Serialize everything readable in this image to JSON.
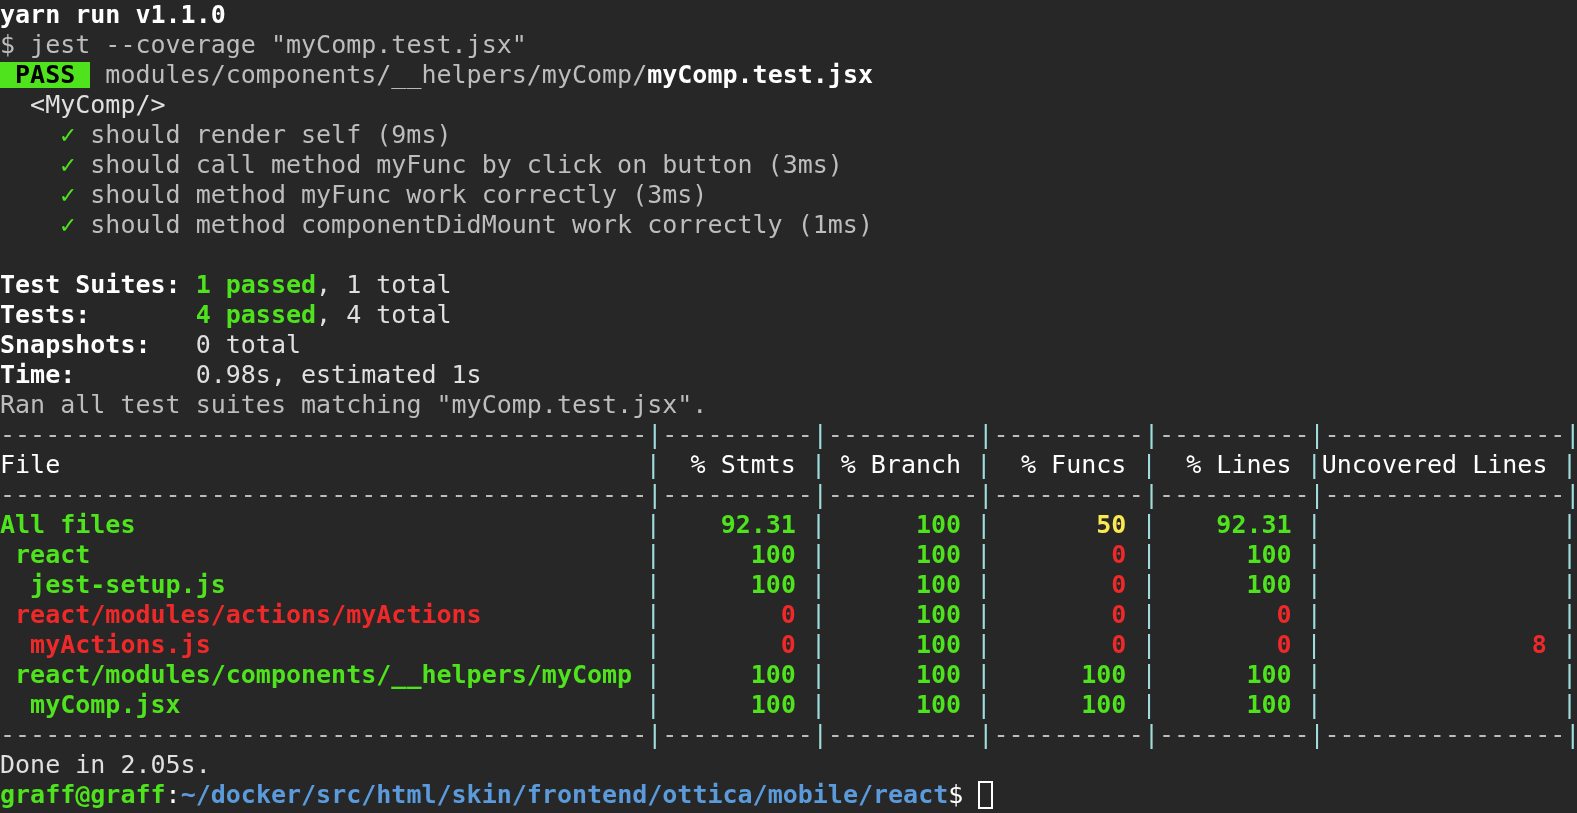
{
  "command": {
    "title": "yarn run v1.1.0",
    "prompt_line": "$ jest --coverage \"myComp.test.jsx\""
  },
  "result": {
    "badge": "PASS",
    "color": "#4ee31c",
    "path": "modules/components/__helpers/myComp/",
    "file": "myComp.test.jsx"
  },
  "suite": {
    "name": "<MyComp/>",
    "tests": [
      {
        "mark": "✓",
        "name": "should render self (9ms)"
      },
      {
        "mark": "✓",
        "name": "should call method myFunc by click on button (3ms)"
      },
      {
        "mark": "✓",
        "name": "should method myFunc work correctly (3ms)"
      },
      {
        "mark": "✓",
        "name": "should method componentDidMount work correctly (1ms)"
      }
    ]
  },
  "summary": [
    {
      "label": "Test Suites:",
      "passed": "1 passed",
      "text": ", 1 total"
    },
    {
      "label": "Tests:",
      "passed": "4 passed",
      "text": ", 4 total"
    },
    {
      "label": "Snapshots:",
      "text": "0 total"
    },
    {
      "label": "Time:",
      "text": "0.98s, estimated 1s"
    }
  ],
  "ran_line": "Ran all test suites matching \"myComp.test.jsx\".",
  "coverage_table": {
    "divider": "|",
    "top_rule": [
      "-------------------------------------------",
      "----------",
      "----------",
      "----------",
      "----------",
      "----------------"
    ],
    "columns": [
      "File",
      "% Stmts",
      "% Branch",
      "% Funcs",
      "% Lines",
      "Uncovered Lines"
    ],
    "header_rule": [
      "-------------------------------------------",
      "----------",
      "----------",
      "----------",
      "----------",
      "----------------"
    ],
    "rows": [
      {
        "file": "All files",
        "color": "#4ee31c",
        "stmts": {
          "value": "92.31",
          "color": "#4ee31c"
        },
        "branch": {
          "value": "100",
          "color": "#4ee31c"
        },
        "funcs": {
          "value": "50",
          "color": "#fce94f"
        },
        "lines": {
          "value": "92.31",
          "color": "#4ee31c"
        },
        "children": [
          {
            "file": "react",
            "color": "#4ee31c",
            "stmts": {
              "value": "100",
              "color": "#4ee31c"
            },
            "branch": {
              "value": "100",
              "color": "#4ee31c"
            },
            "funcs": {
              "value": "0",
              "color": "#ef2929"
            },
            "lines": {
              "value": "100",
              "color": "#4ee31c"
            },
            "children": [
              {
                "file": "jest-setup.js",
                "color": "#4ee31c",
                "stmts": {
                  "value": "100",
                  "color": "#4ee31c"
                },
                "branch": {
                  "value": "100",
                  "color": "#4ee31c"
                },
                "funcs": {
                  "value": "0",
                  "color": "#ef2929"
                },
                "lines": {
                  "value": "100",
                  "color": "#4ee31c"
                }
              }
            ]
          },
          {
            "file": "react/modules/actions/myActions",
            "color": "#ef2929",
            "stmts": {
              "value": "0",
              "color": "#ef2929"
            },
            "branch": {
              "value": "100",
              "color": "#4ee31c"
            },
            "funcs": {
              "value": "0",
              "color": "#ef2929"
            },
            "lines": {
              "value": "0",
              "color": "#ef2929"
            },
            "children": [
              {
                "file": "myActions.js",
                "color": "#ef2929",
                "stmts": {
                  "value": "0",
                  "color": "#ef2929"
                },
                "branch": {
                  "value": "100",
                  "color": "#4ee31c"
                },
                "funcs": {
                  "value": "0",
                  "color": "#ef2929"
                },
                "lines": {
                  "value": "0",
                  "color": "#ef2929"
                },
                "uncovered": "8"
              }
            ]
          },
          {
            "file": "react/modules/components/__helpers/myComp",
            "color": "#4ee31c",
            "stmts": {
              "value": "100",
              "color": "#4ee31c"
            },
            "branch": {
              "value": "100",
              "color": "#4ee31c"
            },
            "funcs": {
              "value": "100",
              "color": "#4ee31c"
            },
            "lines": {
              "value": "100",
              "color": "#4ee31c"
            },
            "children": [
              {
                "file": "myComp.jsx",
                "color": "#4ee31c",
                "stmts": {
                  "value": "100",
                  "color": "#4ee31c"
                },
                "branch": {
                  "value": "100",
                  "color": "#4ee31c"
                },
                "funcs": {
                  "value": "100",
                  "color": "#4ee31c"
                },
                "lines": {
                  "value": "100",
                  "color": "#4ee31c"
                }
              }
            ]
          }
        ]
      }
    ],
    "bottom_rule": [
      "-------------------------------------------",
      "----------",
      "----------",
      "----------",
      "----------",
      "----------------"
    ]
  },
  "done_line": "Done in 2.05s.",
  "prompt": {
    "user": "graff@graff",
    "separator": ":",
    "path": "~/docker/src/html/skin/frontend/ottica/mobile/react",
    "symbol": "$"
  }
}
